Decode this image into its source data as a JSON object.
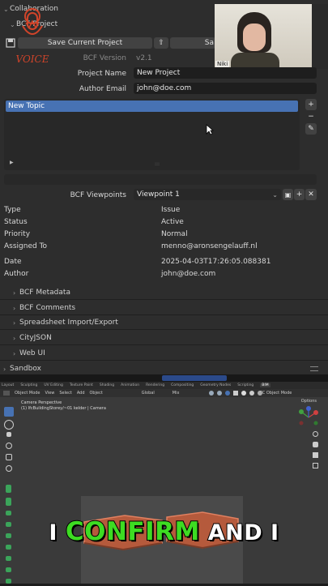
{
  "header": {
    "collaboration": "Collaboration",
    "bcf_project": "BCF Project",
    "logo_word": "VOICE"
  },
  "toolbar": {
    "save_label": "Save Current Project",
    "save2_label": "Sa"
  },
  "webcam": {
    "name": "Niki"
  },
  "project": {
    "version_label": "BCF Version",
    "version_value": "v2.1",
    "name_label": "Project Name",
    "name_value": "New Project",
    "email_label": "Author Email",
    "email_value": "john@doe.com"
  },
  "topics": {
    "items": [
      "New Topic"
    ]
  },
  "viewpoints": {
    "label": "BCF Viewpoints",
    "selected": "Viewpoint 1"
  },
  "details": [
    {
      "key": "Type",
      "value": "Issue"
    },
    {
      "key": "Status",
      "value": "Active"
    },
    {
      "key": "Priority",
      "value": "Normal"
    },
    {
      "key": "Assigned To",
      "value": "menno@aronsengelauff.nl"
    },
    {
      "key": "Date",
      "value": "2025-04-03T17:26:05.088381"
    },
    {
      "key": "Author",
      "value": "john@doe.com"
    }
  ],
  "panels": [
    "BCF Metadata",
    "BCF Comments",
    "Spreadsheet Import/Export",
    "CityJSON",
    "Web UI"
  ],
  "sandbox": "Sandbox",
  "viewport": {
    "tabs": [
      "Layout",
      "Sculpting",
      "UV Editing",
      "Texture Paint",
      "Shading",
      "Animation",
      "Rendering",
      "Compositing",
      "Geometry Nodes",
      "Scripting",
      "BIM"
    ],
    "mode": "Object Mode",
    "menus": [
      "View",
      "Select",
      "Add",
      "Object"
    ],
    "transform": "Global",
    "snap": "Mix",
    "ifc_mode": "IFC Object Mode",
    "options": "Options",
    "cam_title": "Camera Perspective",
    "cam_sub": "(1) IfcBuildingStorey/~01 kelder | Camera"
  },
  "caption": {
    "w1": "I",
    "w2": "CONFIRM",
    "w3": "AND I"
  },
  "colors": {
    "accent": "#4772b3",
    "highlight": "#3ddc22"
  }
}
